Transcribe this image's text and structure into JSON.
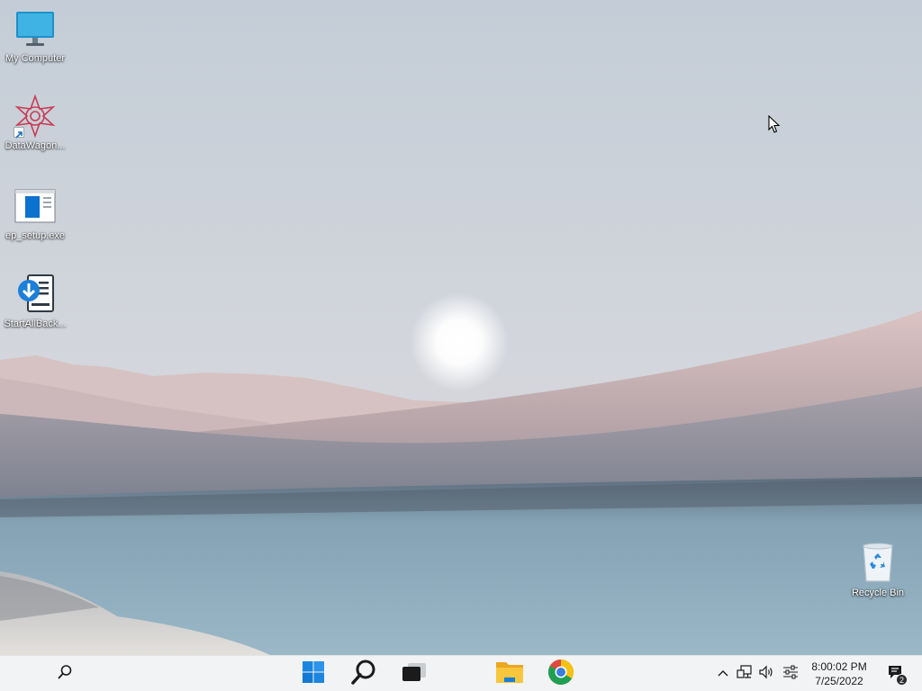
{
  "desktop": {
    "icons": [
      {
        "label": "My Computer",
        "icon": "monitor-icon"
      },
      {
        "label": "DataWagon...",
        "icon": "datawagon-icon"
      },
      {
        "label": "ep_setup.exe",
        "icon": "installer-window-icon"
      },
      {
        "label": "StartAllBack...",
        "icon": "startallback-icon"
      },
      {
        "label": "Recycle Bin",
        "icon": "recycle-bin-icon"
      }
    ]
  },
  "taskbar": {
    "buttons": [
      {
        "name": "search",
        "icon": "search-icon"
      },
      {
        "name": "start",
        "icon": "windows-logo-icon"
      },
      {
        "name": "search-large",
        "icon": "magnifier-icon"
      },
      {
        "name": "task-view",
        "icon": "task-view-icon"
      },
      {
        "name": "file-explorer",
        "icon": "folder-icon"
      },
      {
        "name": "chrome",
        "icon": "chrome-icon"
      }
    ],
    "tray": {
      "time": "8:00:02 PM",
      "date": "7/25/2022",
      "notification_count": "2",
      "icons": [
        "chevron-up-icon",
        "network-icon",
        "volume-icon",
        "settings-sliders-icon",
        "notification-icon"
      ]
    }
  },
  "colors": {
    "taskbar_bg": "#f2f3f4",
    "accent_blue": "#0078d4",
    "folder_yellow": "#f8c63c",
    "sky_top": "#c3ccd6",
    "water": "#8aa7b8"
  }
}
